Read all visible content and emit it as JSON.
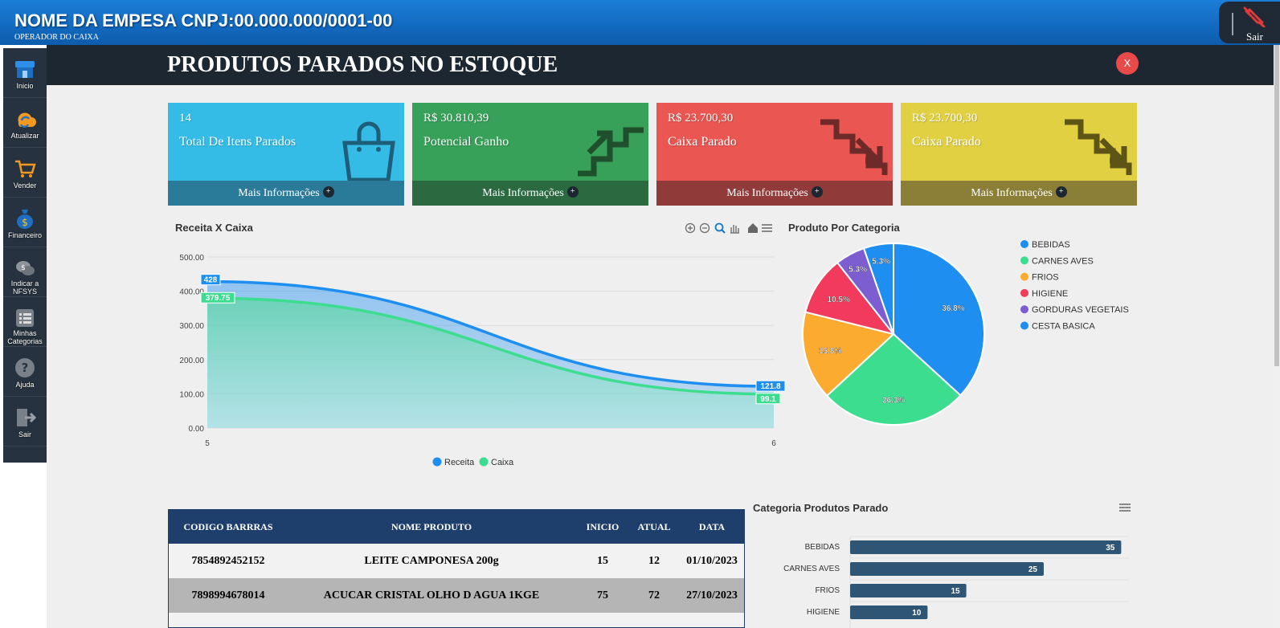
{
  "header": {
    "company": "NOME DA EMPESA CNPJ:00.000.000/0001-00",
    "operator": "OPERADOR DO CAIXA",
    "logout_label": "Sair"
  },
  "sidebar": {
    "items": [
      {
        "label": "Inicio",
        "icon": "store-icon"
      },
      {
        "label": "Atualizar",
        "icon": "refresh-icon"
      },
      {
        "label": "Vender",
        "icon": "cart-icon"
      },
      {
        "label": "Financeiro",
        "icon": "money-bag-icon"
      },
      {
        "label": "Indicar a NFSYS",
        "icon": "chat-money-icon"
      },
      {
        "label": "Minhas Categorias",
        "icon": "list-icon"
      },
      {
        "label": "Ajuda",
        "icon": "help-icon"
      },
      {
        "label": "Sair",
        "icon": "exit-icon"
      }
    ]
  },
  "page": {
    "title": "PRODUTOS PARADOS NO ESTOQUE",
    "close_label": "X"
  },
  "cards": [
    {
      "value": "14",
      "label": "Total De Itens Parados",
      "more": "Mais Informações",
      "color": "#34bce6",
      "foot_color": "#2a7a9a",
      "icon": "shopping-bag-icon"
    },
    {
      "value": "R$ 30.810,39",
      "label": "Potencial Ganho",
      "more": "Mais Informações",
      "color": "#37a059",
      "foot_color": "#2b6a41",
      "icon": "stairs-up-icon"
    },
    {
      "value": "R$ 23.700,30",
      "label": "Caixa Parado",
      "more": "Mais Informações",
      "color": "#ea5651",
      "foot_color": "#903b39",
      "icon": "stairs-down-icon"
    },
    {
      "value": "R$ 23.700,30",
      "label": "Caixa Parado",
      "more": "Mais Informações",
      "color": "#e2d043",
      "foot_color": "#8b7f37",
      "icon": "stairs-down-icon"
    }
  ],
  "colors": {
    "receita": "#1e8ff0",
    "caixa": "#3ddd90",
    "table_header": "#1e3f6b",
    "bar": "#2f5575"
  },
  "chart_data": [
    {
      "type": "area",
      "title": "Receita X Caixa",
      "x": [
        5,
        6
      ],
      "series": [
        {
          "name": "Receita",
          "values": [
            428,
            121.8
          ]
        },
        {
          "name": "Caixa",
          "values": [
            379.75,
            99.1
          ]
        }
      ],
      "ylim": [
        0,
        500
      ],
      "yticks": [
        "0.00",
        "100.00",
        "200.00",
        "300.00",
        "400.00",
        "500.00"
      ],
      "data_labels": [
        "428",
        "379.75",
        "121.8",
        "99.1"
      ],
      "grid": true,
      "legend": "bottom"
    },
    {
      "type": "pie",
      "title": "Produto Por Categoria",
      "categories": [
        "BEBIDAS",
        "CARNES AVES",
        "FRIOS",
        "HIGIENE",
        "GORDURAS VEGETAIS",
        "CESTA BASICA"
      ],
      "values": [
        36.8,
        26.3,
        15.8,
        10.5,
        5.3,
        5.3
      ],
      "labels": [
        "36.8%",
        "26.3%",
        "15.8%",
        "10.5%",
        "5.3%",
        "5.3%"
      ],
      "colors": [
        "#1e8ff0",
        "#3ddd90",
        "#fbab2f",
        "#f23b5c",
        "#7c5ed0",
        "#1e8ff0"
      ],
      "legend": "right"
    },
    {
      "type": "bar",
      "orientation": "horizontal",
      "title": "Categoria Produtos Parado",
      "categories": [
        "BEBIDAS",
        "CARNES AVES",
        "FRIOS",
        "HIGIENE"
      ],
      "values": [
        35,
        25,
        15,
        10
      ],
      "xlim": [
        0,
        36
      ]
    }
  ],
  "table": {
    "headers": [
      "CODIGO BARRRAS",
      "NOME PRODUTO",
      "INICIO",
      "ATUAL",
      "DATA"
    ],
    "rows": [
      [
        "7854892452152",
        "LEITE CAMPONESA 200g",
        "15",
        "12",
        "01/10/2023"
      ],
      [
        "7898994678014",
        "ACUCAR CRISTAL OLHO D AGUA 1KGE",
        "75",
        "72",
        "27/10/2023"
      ]
    ]
  }
}
